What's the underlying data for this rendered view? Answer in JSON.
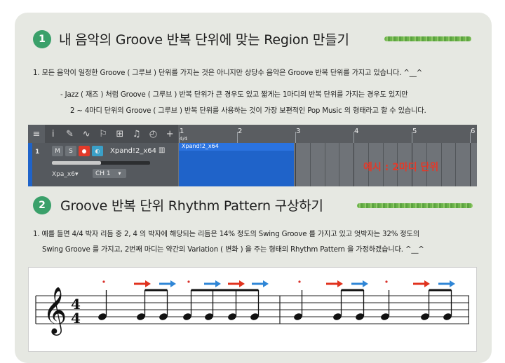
{
  "section1": {
    "number": "1",
    "title": "내 음악의 Groove 반복 단위에 맞는 Region 만들기",
    "line1": "1. 모든 음악이 일정한 Groove ( 그루브 ) 단위를 가지는 것은 아니지만 상당수 음악은 Groove 반복 단위를 가지고 있습니다. ^__^",
    "line2": "- Jazz ( 재즈 ) 처럼 Groove ( 그루브 ) 반복 단위가 큰 경우도 있고 짧게는 1마디의 반복 단위를 가지는 경우도 있지만",
    "line3": "2 ~ 4마디 단위의 Groove ( 그루브 ) 반복 단위를 사용하는 것이 가장 보편적인 Pop Music 의 형태라고 할 수 있습니다."
  },
  "daw": {
    "track_number": "1",
    "mute": "M",
    "solo": "S",
    "track_name": "Xpand!2_x64",
    "region_name": "Xpand!2_x64",
    "instrument": "Xpa_x6▾",
    "channel": "CH 1",
    "time_signature": "4/4",
    "ruler": [
      "1",
      "2",
      "3",
      "4",
      "5",
      "6"
    ],
    "example_label": "예시 : 2마디 단위",
    "colors": {
      "region": "#1f63c9",
      "record": "#e23a2a"
    }
  },
  "section2": {
    "number": "2",
    "title": "Groove 반복 단위 Rhythm Pattern 구상하기",
    "line1": "1. 예를 들면 4/4 박자 리듬 중 2, 4 의 박자에 해당되는 리듬은 14% 정도의 Swing Groove 를 가지고 있고 엇박자는 32% 정도의",
    "line2": "Swing Groove 를 가지고, 2번째 마디는 약간의 Variation ( 변화 ) 을 주는 형태의 Rhythm Pattern 을 가정하겠습니다. ^__^"
  },
  "staff": {
    "time_top": "4",
    "time_bottom": "4",
    "colors": {
      "red_arrow": "#e0321e",
      "blue_arrow": "#2f86d6",
      "dot": "#d9302a"
    }
  }
}
